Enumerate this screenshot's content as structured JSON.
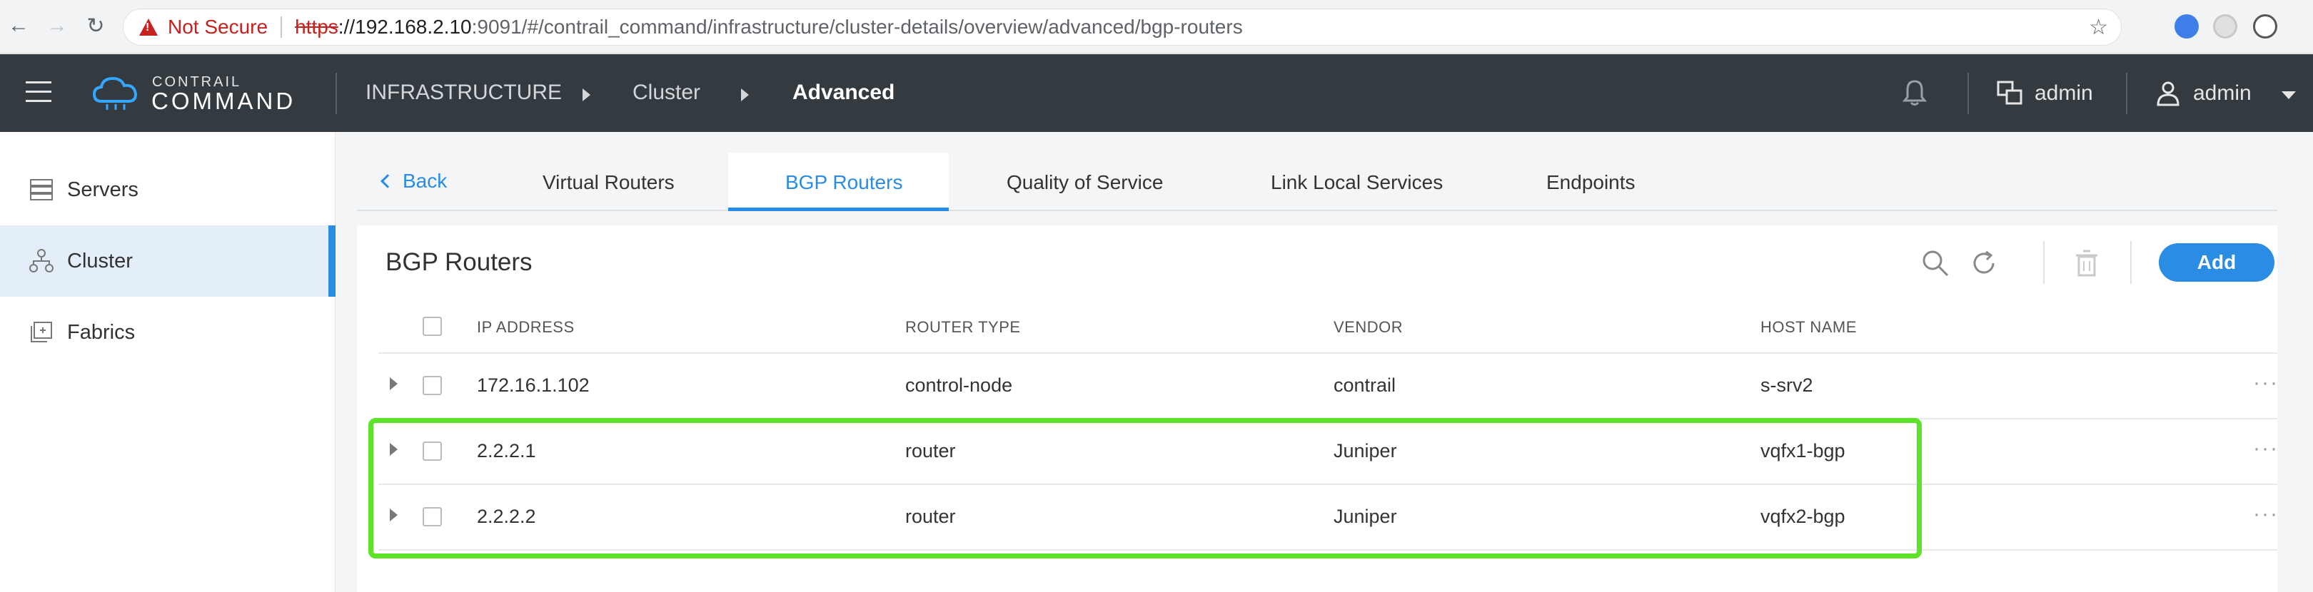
{
  "browser": {
    "security_label": "Not Secure",
    "url_scheme": "https",
    "url_host": "://192.168.2.10",
    "url_rest": ":9091/#/contrail_command/infrastructure/cluster-details/overview/advanced/bgp-routers"
  },
  "header": {
    "logo_top": "CONTRAIL",
    "logo_bottom": "COMMAND",
    "breadcrumb": [
      "INFRASTRUCTURE",
      "Cluster",
      "Advanced"
    ],
    "tenant_label": "admin",
    "user_label": "admin"
  },
  "sidebar": {
    "items": [
      {
        "label": "Servers",
        "icon": "servers-icon"
      },
      {
        "label": "Cluster",
        "icon": "cluster-icon"
      },
      {
        "label": "Fabrics",
        "icon": "fabrics-icon"
      }
    ]
  },
  "tabs": {
    "back_label": "Back",
    "items": [
      "Virtual Routers",
      "BGP Routers",
      "Quality of Service",
      "Link Local Services",
      "Endpoints"
    ],
    "active": "BGP Routers"
  },
  "panel": {
    "title": "BGP Routers",
    "add_label": "Add",
    "columns": [
      "IP ADDRESS",
      "ROUTER TYPE",
      "VENDOR",
      "HOST NAME"
    ],
    "rows": [
      {
        "ip": "172.16.1.102",
        "type": "control-node",
        "vendor": "contrail",
        "host": "s-srv2"
      },
      {
        "ip": "2.2.2.1",
        "type": "router",
        "vendor": "Juniper",
        "host": "vqfx1-bgp"
      },
      {
        "ip": "2.2.2.2",
        "type": "router",
        "vendor": "Juniper",
        "host": "vqfx2-bgp"
      }
    ],
    "row_menu_label": "···"
  },
  "colors": {
    "accent": "#2b8ce4",
    "header_bg": "#333a40",
    "highlight": "#5fe32a",
    "warning": "#c5221f"
  }
}
